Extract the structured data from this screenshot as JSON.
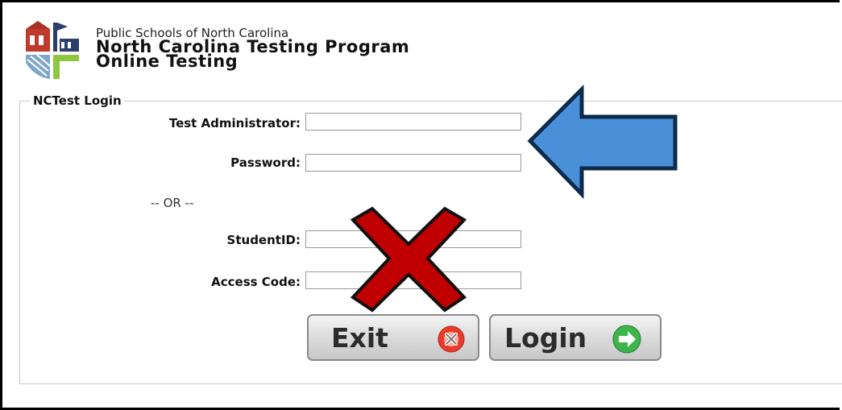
{
  "header": {
    "org": "Public Schools of North Carolina",
    "program": "North Carolina Testing Program",
    "subtitle": "Online Testing"
  },
  "login": {
    "legend": "NCTest Login",
    "admin_label": "Test Administrator:",
    "admin_value": "",
    "password_label": "Password:",
    "password_value": "",
    "or_text": "-- OR --",
    "student_label": "StudentID:",
    "student_value": "",
    "access_label": "Access Code:",
    "access_value": ""
  },
  "buttons": {
    "exit_label": "Exit",
    "login_label": "Login"
  },
  "colors": {
    "arrow": "#4a90d9",
    "arrow_outline": "#0e2a4a",
    "cross": "#c00000",
    "exit_icon": "#e8392a",
    "login_icon": "#3db54a"
  },
  "icons": {
    "exit": "x-circle-icon",
    "login": "arrow-right-circle-icon"
  }
}
